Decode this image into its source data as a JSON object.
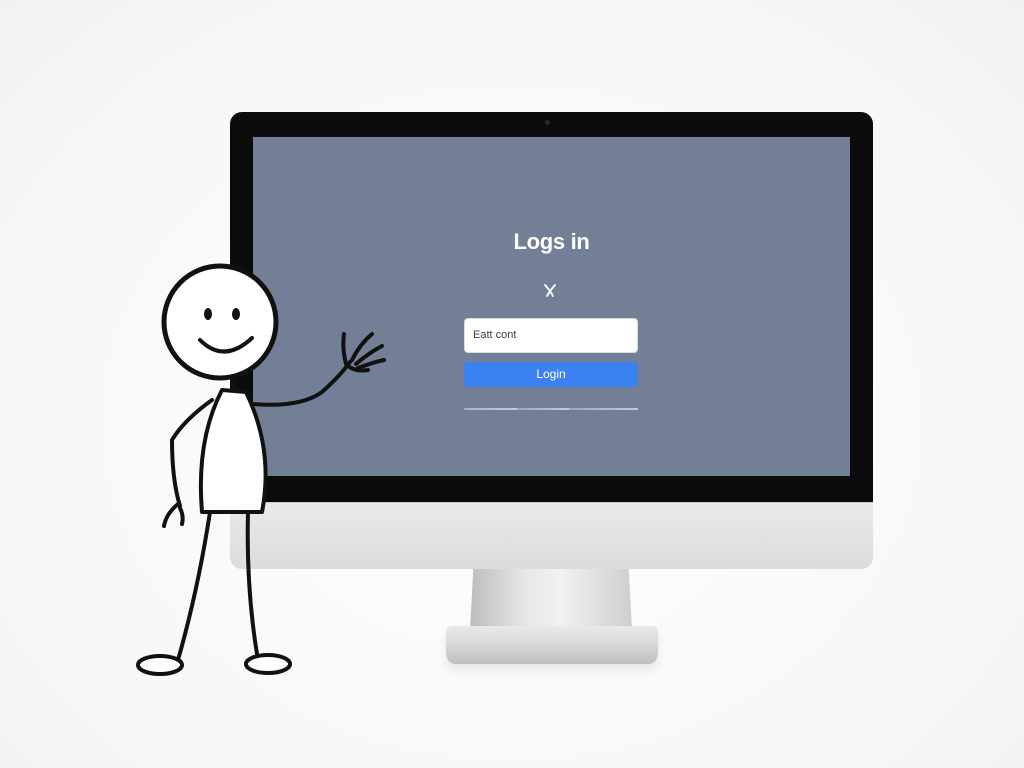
{
  "login": {
    "title": "Logs in",
    "icon": "key-icon",
    "input_value": "Eatt cont",
    "button_label": "Login"
  },
  "colors": {
    "screen_bg": "#737f96",
    "button_bg": "#3b82f0",
    "bezel": "#0b0b0c"
  }
}
